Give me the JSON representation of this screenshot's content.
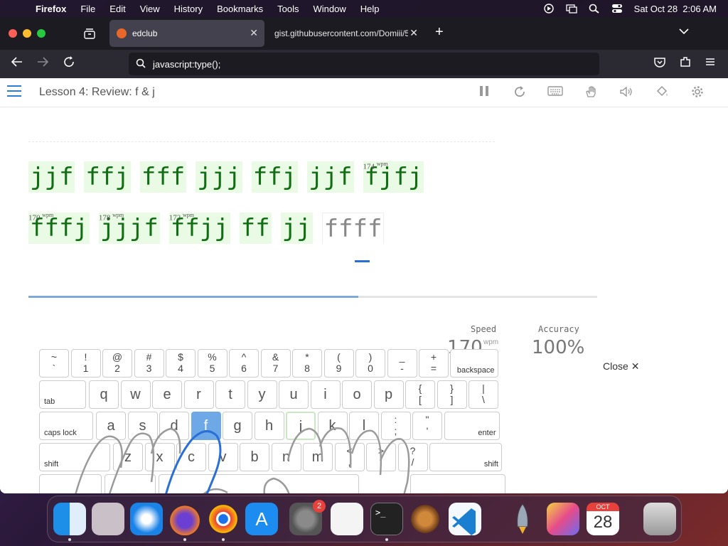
{
  "menubar": {
    "app": "Firefox",
    "items": [
      "File",
      "Edit",
      "View",
      "History",
      "Bookmarks",
      "Tools",
      "Window",
      "Help"
    ],
    "clock": "Sat Oct 28  2:06 AM"
  },
  "tabs": [
    {
      "title": "edclub",
      "active": true
    },
    {
      "title": "gist.githubusercontent.com/Domiii/5",
      "active": false
    }
  ],
  "url": "javascript:type();",
  "lesson": {
    "title": "Lesson 4: Review: f & j"
  },
  "typing": {
    "line1": [
      {
        "w": "jjf",
        "wpm": null
      },
      {
        "w": "ffj",
        "wpm": null
      },
      {
        "w": "fff",
        "wpm": null
      },
      {
        "w": "jjj",
        "wpm": null
      },
      {
        "w": "ffj",
        "wpm": null
      },
      {
        "w": "jjf",
        "wpm": null
      },
      {
        "w": "fjfj",
        "wpm": "174"
      }
    ],
    "line2": [
      {
        "w": "fffj",
        "wpm": "170"
      },
      {
        "w": "jjjf",
        "wpm": "178"
      },
      {
        "w": "ffjj",
        "wpm": "172"
      },
      {
        "w": "ff",
        "wpm": null
      },
      {
        "w": "jj",
        "wpm": null
      },
      {
        "w": "ffff",
        "wpm": null,
        "current": true
      }
    ],
    "wpm_unit": "wpm",
    "progress": 0.58
  },
  "stats": {
    "speed_label": "Speed",
    "speed_value": "170",
    "speed_unit": "wpm",
    "accuracy_label": "Accuracy",
    "accuracy_value": "100%"
  },
  "close_label": "Close",
  "keyboard": {
    "row1": [
      [
        "~",
        "`"
      ],
      [
        "!",
        "1"
      ],
      [
        "@",
        "2"
      ],
      [
        "#",
        "3"
      ],
      [
        "$",
        "4"
      ],
      [
        "%",
        "5"
      ],
      [
        "^",
        "6"
      ],
      [
        "&",
        "7"
      ],
      [
        "*",
        "8"
      ],
      [
        "(",
        "9"
      ],
      [
        ")",
        "0"
      ],
      [
        "_",
        "-"
      ],
      [
        "+",
        "="
      ]
    ],
    "backspace": "backspace",
    "tab": "tab",
    "row2": [
      "q",
      "w",
      "e",
      "r",
      "t",
      "y",
      "u",
      "i",
      "o",
      "p"
    ],
    "row2_sym": [
      [
        "{",
        "["
      ],
      [
        "}",
        "]"
      ],
      [
        "|",
        "\\"
      ]
    ],
    "caps": "caps lock",
    "row3": [
      "a",
      "s",
      "d",
      "f",
      "g",
      "h",
      "j",
      "k",
      "l"
    ],
    "row3_sym": [
      [
        ":",
        ";"
      ],
      [
        "\"",
        "'"
      ]
    ],
    "enter": "enter",
    "shift_left": "shift",
    "row4": [
      "z",
      "x",
      "c",
      "v",
      "b",
      "n",
      "m"
    ],
    "row4_sym": [
      [
        "<",
        ","
      ],
      [
        ">",
        "."
      ],
      [
        "?",
        "/"
      ]
    ],
    "shift_right": "shift",
    "highlight_key": "f",
    "home_key": "j"
  },
  "dock": {
    "calendar_month": "OCT",
    "calendar_day": "28",
    "settings_badge": "2"
  },
  "colors": {
    "accent": "#2a7dd6",
    "correct_bg": "#eafbe5",
    "correct_text": "#0f6e12",
    "highlight": "#6fa8e6"
  }
}
